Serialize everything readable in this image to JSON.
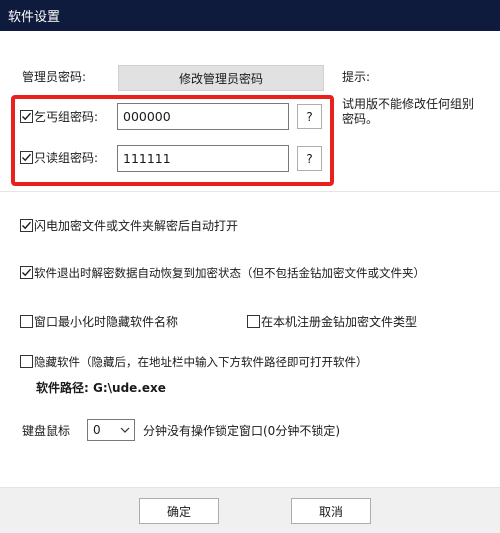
{
  "window": {
    "title": "软件设置"
  },
  "admin": {
    "label": "管理员密码:",
    "change_button": "修改管理员密码"
  },
  "hint": {
    "title": "提示:",
    "text_line1": "试用版不能修改任何组别",
    "text_line2": "密码。"
  },
  "groups": [
    {
      "label": "乞丐组密码:",
      "checked": true,
      "value": "000000",
      "help": "?"
    },
    {
      "label": "只读组密码:",
      "checked": true,
      "value": "111111",
      "help": "?"
    }
  ],
  "options": {
    "flash_autoopen": {
      "label": "闪电加密文件或文件夹解密后自动打开",
      "checked": true
    },
    "exit_restore": {
      "label": "软件退出时解密数据自动恢复到加密状态（但不包括金钻加密文件或文件夹）",
      "checked": true
    },
    "minimize_hide": {
      "label": "窗口最小化时隐藏软件名称",
      "checked": false
    },
    "register_type": {
      "label": "在本机注册金钻加密文件类型",
      "checked": false
    },
    "hide_software": {
      "label": "隐藏软件（隐藏后，在地址栏中输入下方软件路径即可打开软件）",
      "checked": false
    }
  },
  "path": {
    "label": "软件路径:",
    "value": "G:\\ude.exe"
  },
  "lock": {
    "label": "键盘鼠标",
    "minutes": "0",
    "suffix": "分钟没有操作锁定窗口(0分钟不锁定)"
  },
  "footer": {
    "ok": "确定",
    "cancel": "取消"
  },
  "colors": {
    "titlebar": "#0f1b3d",
    "highlight": "#e8211d",
    "checkmark": "#1a1a1a"
  }
}
